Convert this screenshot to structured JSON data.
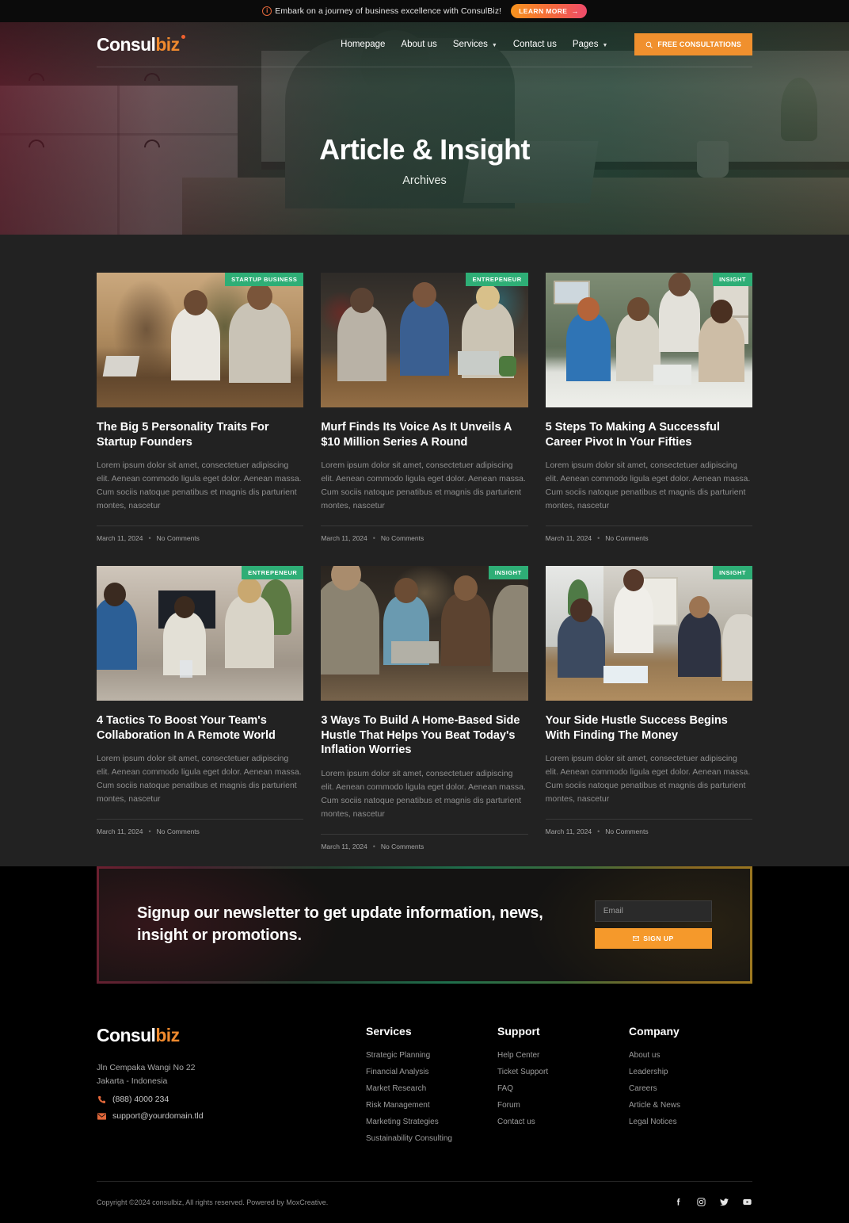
{
  "topbar": {
    "icon": "info-circle-icon",
    "message": "Embark on a journey of business excellence with ConsulBiz!",
    "cta_label": "LEARN MORE",
    "cta_arrow": "→"
  },
  "header": {
    "logo": {
      "part1": "Consul",
      "part2": "biz"
    },
    "nav": [
      {
        "label": "Homepage",
        "has_dropdown": false
      },
      {
        "label": "About us",
        "has_dropdown": false
      },
      {
        "label": "Services",
        "has_dropdown": true
      },
      {
        "label": "Contact us",
        "has_dropdown": false
      },
      {
        "label": "Pages",
        "has_dropdown": true
      }
    ],
    "cta": {
      "label": "FREE CONSULTATIONS",
      "icon": "search-badge-icon"
    }
  },
  "hero": {
    "title": "Article & Insight",
    "subtitle": "Archives"
  },
  "articles": [
    {
      "badge": "STARTUP BUSINESS",
      "title": "The Big 5 Personality Traits For Startup Founders",
      "excerpt": "Lorem ipsum dolor sit amet, consectetuer adipiscing elit. Aenean commodo ligula eget dolor. Aenean massa. Cum sociis natoque penatibus et magnis dis parturient montes, nascetur",
      "date": "March 11, 2024",
      "comments": "No Comments"
    },
    {
      "badge": "ENTREPENEUR",
      "title": "Murf Finds Its Voice As It Unveils A $10 Million Series A Round",
      "excerpt": "Lorem ipsum dolor sit amet, consectetuer adipiscing elit. Aenean commodo ligula eget dolor. Aenean massa. Cum sociis natoque penatibus et magnis dis parturient montes, nascetur",
      "date": "March 11, 2024",
      "comments": "No Comments"
    },
    {
      "badge": "INSIGHT",
      "title": "5 Steps To Making A Successful Career Pivot In Your Fifties",
      "excerpt": "Lorem ipsum dolor sit amet, consectetuer adipiscing elit. Aenean commodo ligula eget dolor. Aenean massa. Cum sociis natoque penatibus et magnis dis parturient montes, nascetur",
      "date": "March 11, 2024",
      "comments": "No Comments"
    },
    {
      "badge": "ENTREPENEUR",
      "title": "4 Tactics To Boost Your Team's Collaboration In A Remote World",
      "excerpt": "Lorem ipsum dolor sit amet, consectetuer adipiscing elit. Aenean commodo ligula eget dolor. Aenean massa. Cum sociis natoque penatibus et magnis dis parturient montes, nascetur",
      "date": "March 11, 2024",
      "comments": "No Comments"
    },
    {
      "badge": "INSIGHT",
      "title": "3 Ways To Build A Home-Based Side Hustle That Helps You Beat Today's Inflation Worries",
      "excerpt": "Lorem ipsum dolor sit amet, consectetuer adipiscing elit. Aenean commodo ligula eget dolor. Aenean massa. Cum sociis natoque penatibus et magnis dis parturient montes, nascetur",
      "date": "March 11, 2024",
      "comments": "No Comments"
    },
    {
      "badge": "INSIGHT",
      "title": "Your Side Hustle Success Begins With Finding The Money",
      "excerpt": "Lorem ipsum dolor sit amet, consectetuer adipiscing elit. Aenean commodo ligula eget dolor. Aenean massa. Cum sociis natoque penatibus et magnis dis parturient montes, nascetur",
      "date": "March 11, 2024",
      "comments": "No Comments"
    }
  ],
  "newsletter": {
    "heading": "Signup our newsletter to get update information, news, insight or promotions.",
    "email_placeholder": "Email",
    "email_value": "",
    "button_label": "SIGN UP",
    "button_icon": "envelope-icon"
  },
  "footer": {
    "logo": {
      "part1": "Consul",
      "part2": "biz"
    },
    "address_line1": "Jln Cempaka Wangi No 22",
    "address_line2": "Jakarta - Indonesia",
    "phone": "(888) 4000 234",
    "phone_icon": "phone-icon",
    "email": "support@yourdomain.tld",
    "email_icon": "mail-icon",
    "columns": [
      {
        "heading": "Services",
        "links": [
          "Strategic Planning",
          "Financial Analysis",
          "Market Research",
          "Risk Management",
          "Marketing Strategies",
          "Sustainability Consulting"
        ]
      },
      {
        "heading": "Support",
        "links": [
          "Help Center",
          "Ticket Support",
          "FAQ",
          "Forum",
          "Contact us"
        ]
      },
      {
        "heading": "Company",
        "links": [
          "About us",
          "Leadership",
          "Careers",
          "Article & News",
          "Legal Notices"
        ]
      }
    ],
    "copyright": "Copyright ©2024 consulbiz, All rights reserved. Powered by MoxCreative.",
    "socials": [
      "facebook-icon",
      "instagram-icon",
      "twitter-icon",
      "youtube-icon"
    ]
  },
  "colors": {
    "accent_orange": "#F0902E",
    "badge_green": "#2EAE76",
    "page_bg": "#222222",
    "footer_bg": "#000000",
    "logo_orange": "#F08A2E"
  }
}
